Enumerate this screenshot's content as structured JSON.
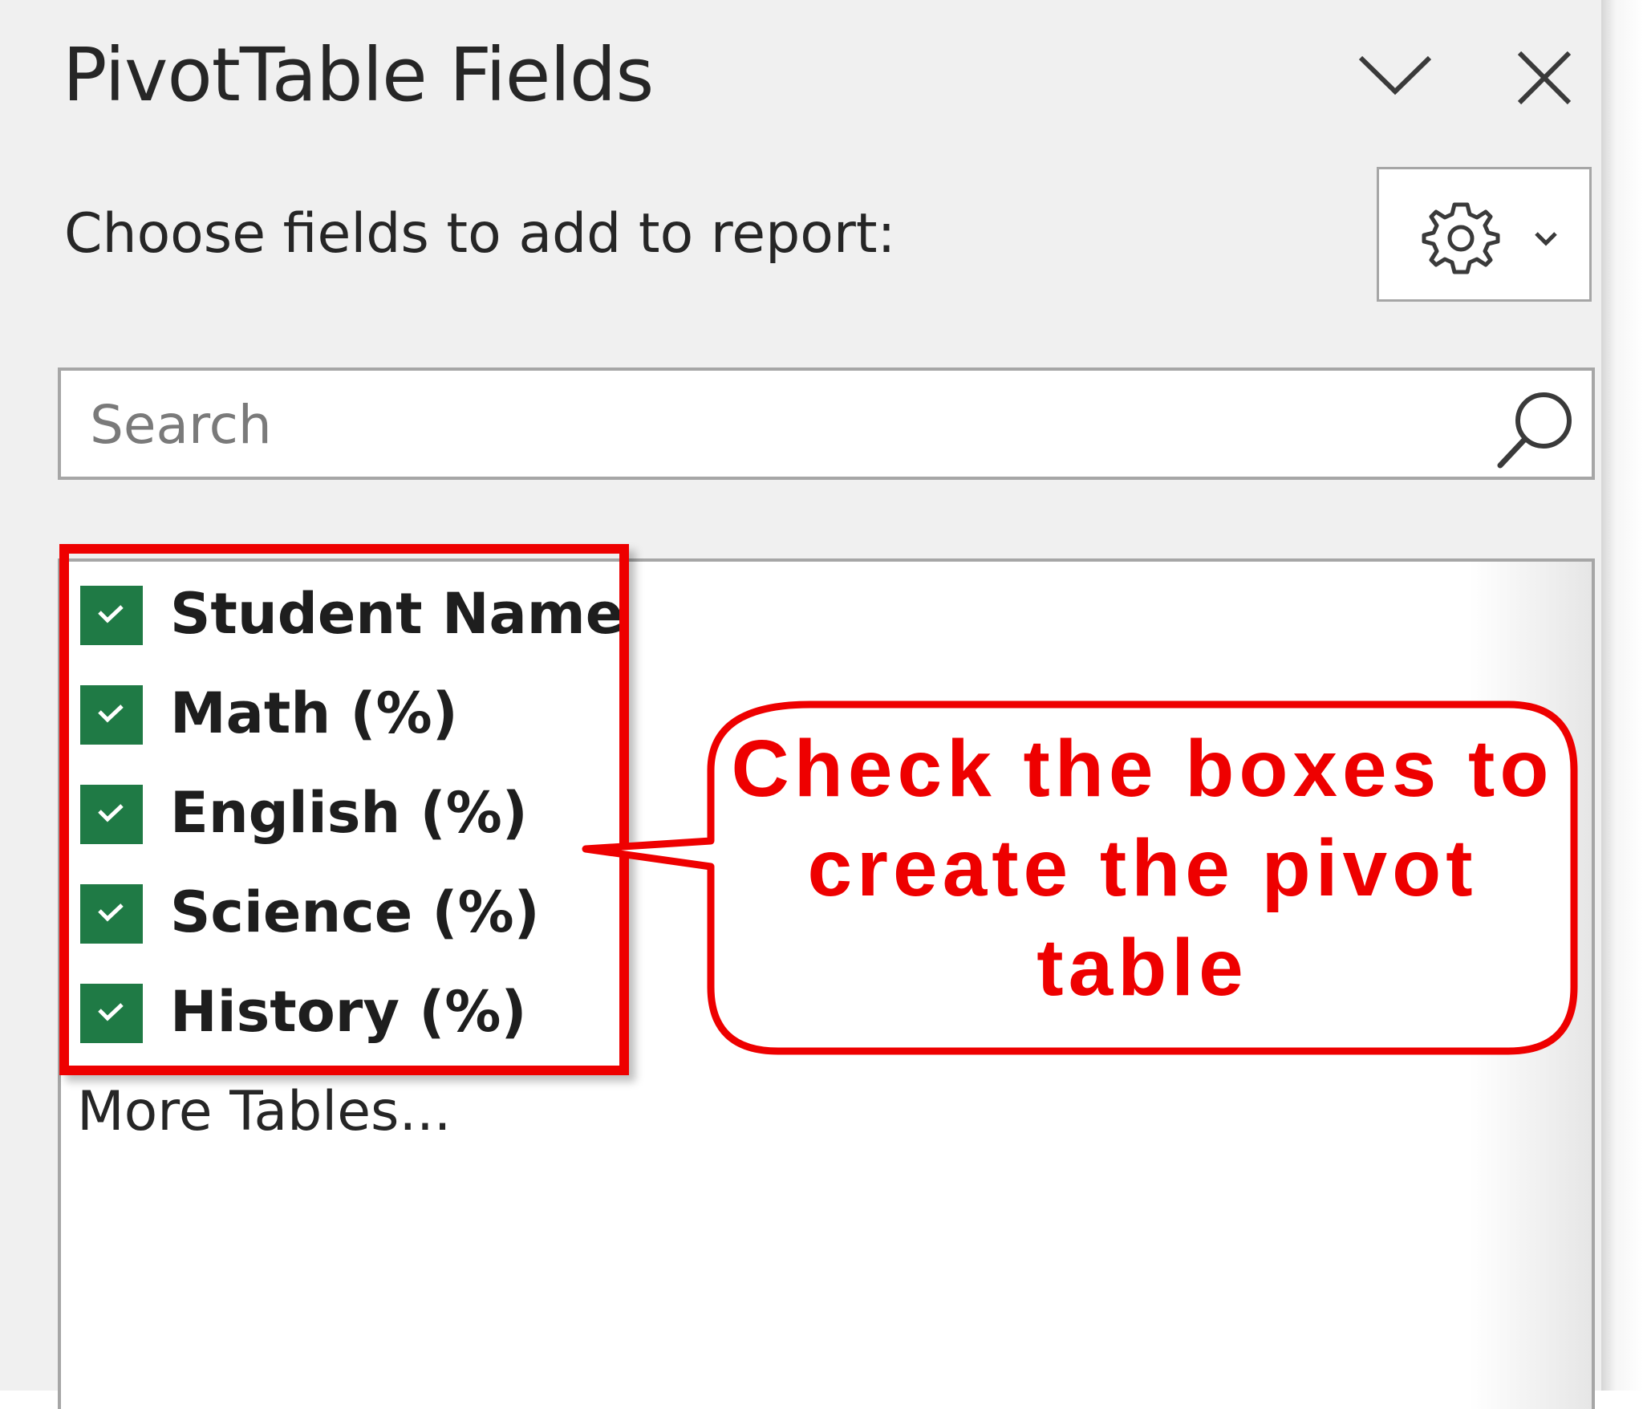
{
  "pane": {
    "title": "PivotTable Fields",
    "subtitle": "Choose fields to add to report:",
    "collapse_icon": "chevron-down-icon",
    "close_icon": "close-icon",
    "tools_icon": "gear-icon"
  },
  "search": {
    "placeholder": "Search",
    "value": ""
  },
  "fields": [
    {
      "label": "Student Name",
      "checked": true
    },
    {
      "label": "Math (%)",
      "checked": true
    },
    {
      "label": "English (%)",
      "checked": true
    },
    {
      "label": "Science (%)",
      "checked": true
    },
    {
      "label": "History (%)",
      "checked": true
    }
  ],
  "more_tables_label": "More Tables...",
  "annotation": {
    "text": "Check the boxes to create the pivot table"
  },
  "colors": {
    "checkbox": "#1f7a45",
    "annotation": "#ee0000"
  }
}
